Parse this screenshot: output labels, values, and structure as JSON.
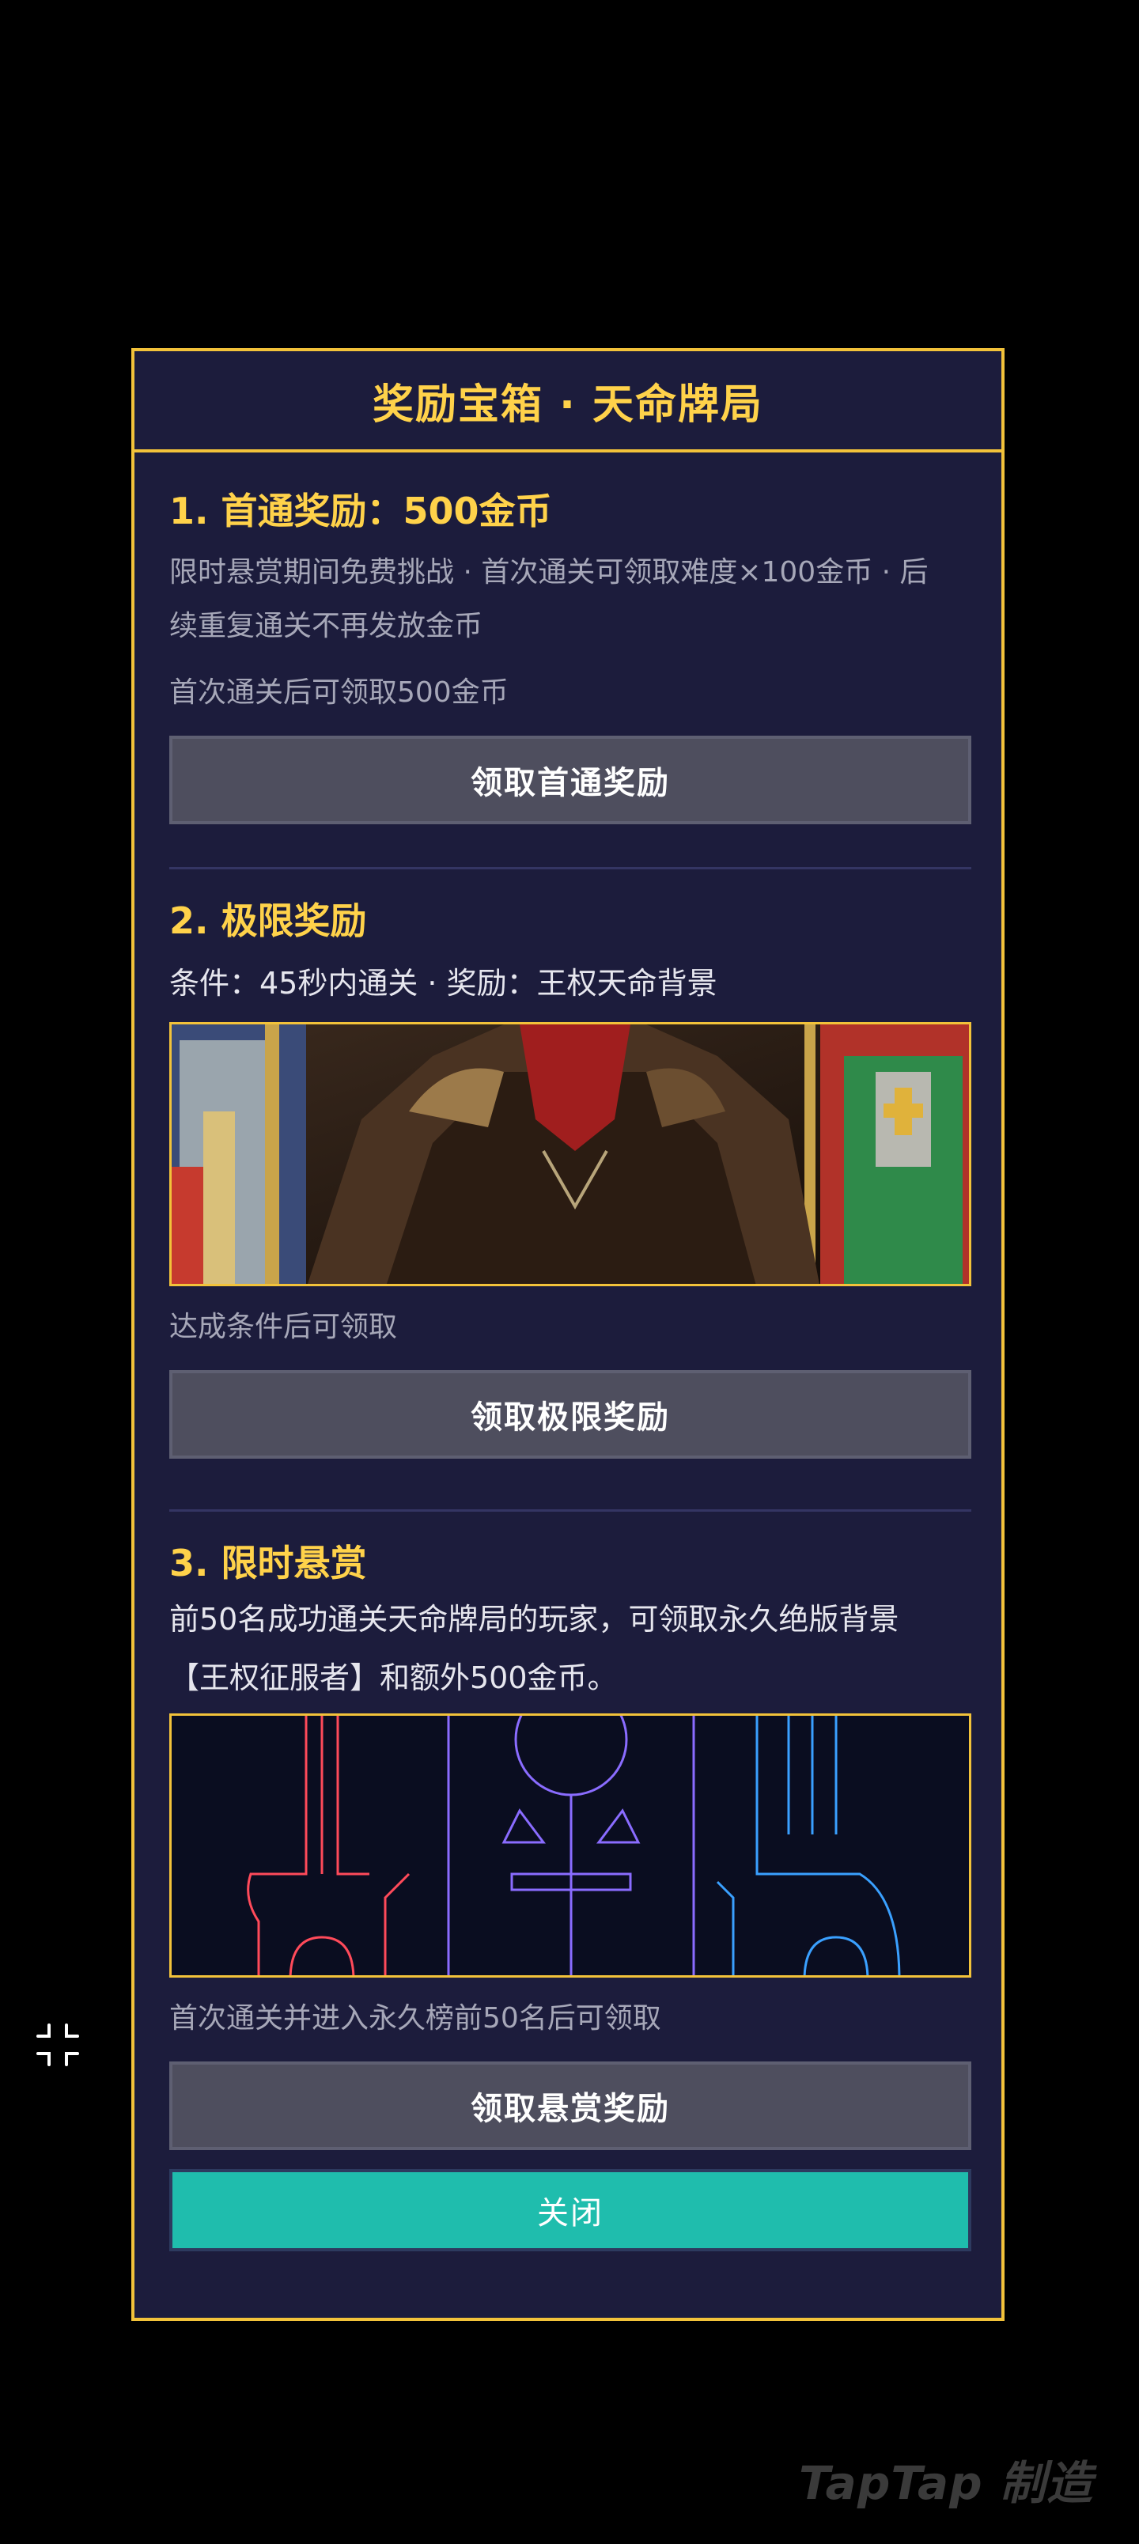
{
  "modal": {
    "title": "奖励宝箱 · 天命牌局"
  },
  "sections": [
    {
      "title": "1. 首通奖励：500金币",
      "lines": [
        "限时悬赏期间免费挑战 · 首次通关可领取难度×100金币 · 后",
        "续重复通关不再发放金币"
      ],
      "status": "首次通关后可领取500金币",
      "button_label": "领取首通奖励"
    },
    {
      "title": "2. 极限奖励",
      "condition": "条件：45秒内通关 · 奖励：王权天命背景",
      "status": "达成条件后可领取",
      "button_label": "领取极限奖励",
      "banner_name": "royal-destiny-background"
    },
    {
      "title": "3. 限时悬赏",
      "lines": [
        "前50名成功通关天命牌局的玩家，可领取永久绝版背景",
        "【王权征服者】和额外500金币。"
      ],
      "status": "首次通关并进入永久榜前50名后可领取",
      "button_label": "领取悬赏奖励",
      "banner_name": "royal-conqueror-background"
    }
  ],
  "close_label": "关闭",
  "watermark": "TapTap 制造",
  "colors": {
    "accent_gold": "#ffd24a",
    "panel_bg": "#1c1c3c",
    "close_teal": "#1fbdad",
    "button_gray": "#4e4e5e"
  },
  "icons": {
    "corner": "collapse-icon"
  }
}
